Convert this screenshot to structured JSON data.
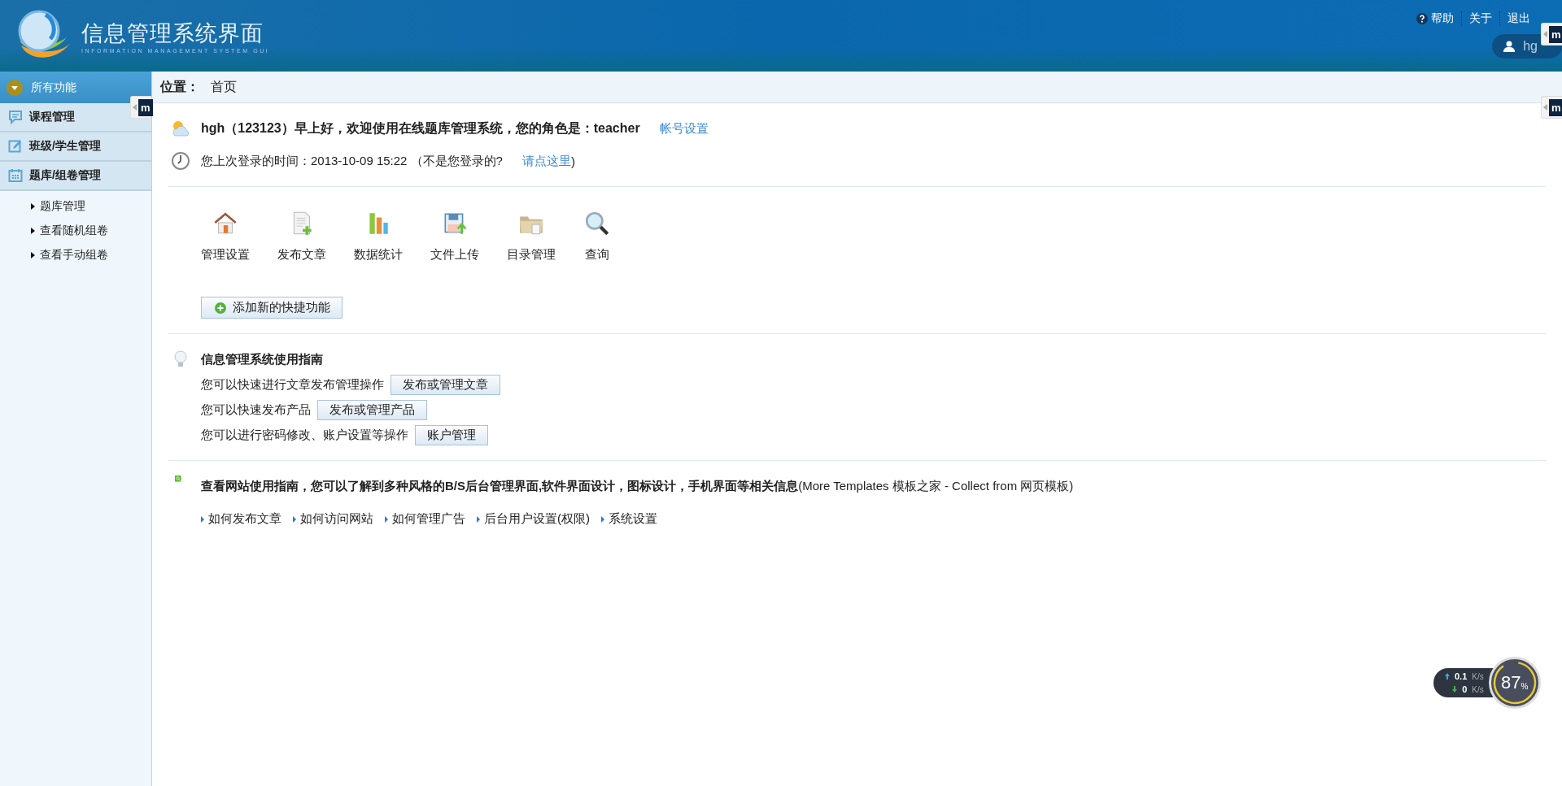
{
  "header": {
    "title": "信息管理系统界面",
    "subtitle": "INFORMATION MANAGEMENT SYSTEM GUI",
    "links": [
      {
        "label": "帮助",
        "kind": "help"
      },
      {
        "label": "关于",
        "kind": "plain"
      },
      {
        "label": "退出",
        "kind": "plain"
      }
    ],
    "user": "hg"
  },
  "sidebar": {
    "title": "所有功能",
    "groups": [
      {
        "label": "课程管理",
        "kind": "chat"
      },
      {
        "label": "班级/学生管理",
        "kind": "edit"
      },
      {
        "label": "题库/组卷管理",
        "kind": "calendar",
        "children": [
          {
            "label": "题库管理"
          },
          {
            "label": "查看随机组卷"
          },
          {
            "label": "查看手动组卷"
          }
        ]
      }
    ]
  },
  "breadcrumb": {
    "label": "位置：",
    "value": "首页"
  },
  "greeting": {
    "text": "hgh（123123）早上好，欢迎使用在线题库管理系统，您的角色是：teacher",
    "link": "帐号设置"
  },
  "last_login": {
    "text": "您上次登录的时间：2013-10-09 15:22 （不是您登录的?",
    "link": "请点这里",
    "suffix": ")"
  },
  "shortcuts": [
    {
      "label": "管理设置",
      "kind": "house"
    },
    {
      "label": "发布文章",
      "kind": "doc-add"
    },
    {
      "label": "数据统计",
      "kind": "chart"
    },
    {
      "label": "文件上传",
      "kind": "save"
    },
    {
      "label": "目录管理",
      "kind": "folder"
    },
    {
      "label": "查询",
      "kind": "search"
    }
  ],
  "add_shortcut": "添加新的快捷功能",
  "guide": {
    "title": "信息管理系统使用指南",
    "rows": [
      {
        "text": "您可以快速进行文章发布管理操作",
        "button": "发布或管理文章"
      },
      {
        "text": "您可以快速发布产品",
        "button": "发布或管理产品"
      },
      {
        "text": "您可以进行密码修改、账户设置等操作",
        "button": "账户管理"
      }
    ]
  },
  "info": {
    "title": "**查看网站使用指南，您可以了解到多种风格的B/S后台管理界面,软件界面设计，图标设计，手机界面等相关信息**(More Templates 模板之家 - Collect from 网页模板)",
    "links": [
      "如何发布文章",
      "如何访问网站",
      "如何管理广告",
      "后台用户设置(权限)",
      "系统设置"
    ]
  },
  "side_tabs": [
    "m",
    "m",
    "m"
  ],
  "net_meter": {
    "up": "0.1",
    "down": "0",
    "unit_up": "K/s",
    "unit_down": "K/s",
    "percent": "87",
    "percent_sign": "%"
  }
}
